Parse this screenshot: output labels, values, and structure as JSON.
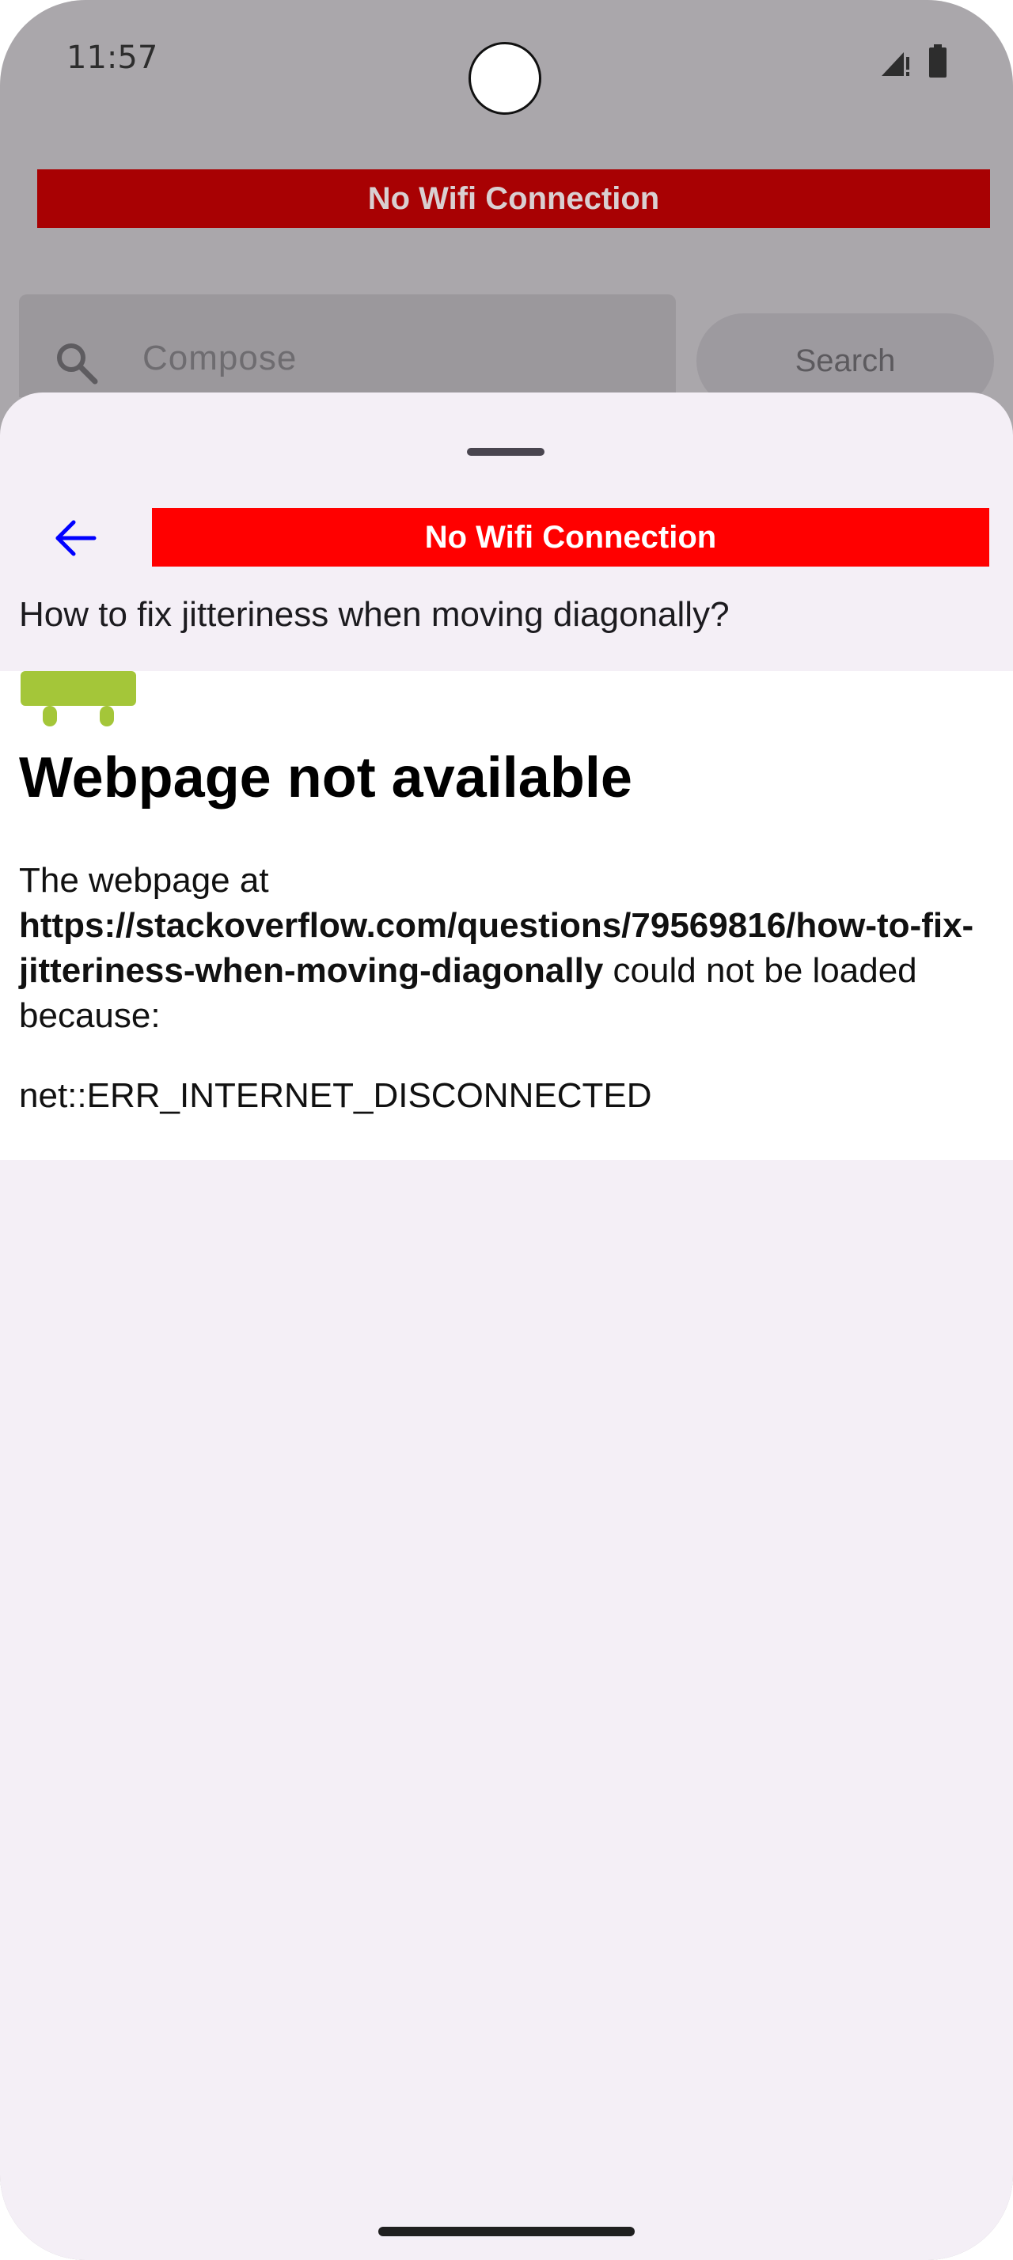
{
  "status_bar": {
    "time": "11:57"
  },
  "background_app": {
    "banner": "No Wifi Connection",
    "search_placeholder": "Compose",
    "search_button": "Search"
  },
  "sheet": {
    "banner": "No Wifi Connection",
    "page_title": "How to fix jitteriness when moving diagonally?"
  },
  "webview": {
    "heading": "Webpage not available",
    "body_prefix": "The webpage at",
    "url": "https://stackoverflow.com/questions/79569816/how-to-fix-jitteriness-when-moving-diagonally",
    "body_suffix": "could not be loaded because:",
    "error_code": "net::ERR_INTERNET_DISCONNECTED"
  },
  "colors": {
    "banner_active": "#ff0000",
    "banner_dimmed": "#a80103",
    "back_arrow": "#0000ff",
    "android_green": "#a4c639",
    "sheet_bg": "#f4eff6"
  },
  "icons": [
    "back-arrow-icon",
    "search-icon",
    "signal-icon",
    "battery-icon",
    "android-icon"
  ]
}
